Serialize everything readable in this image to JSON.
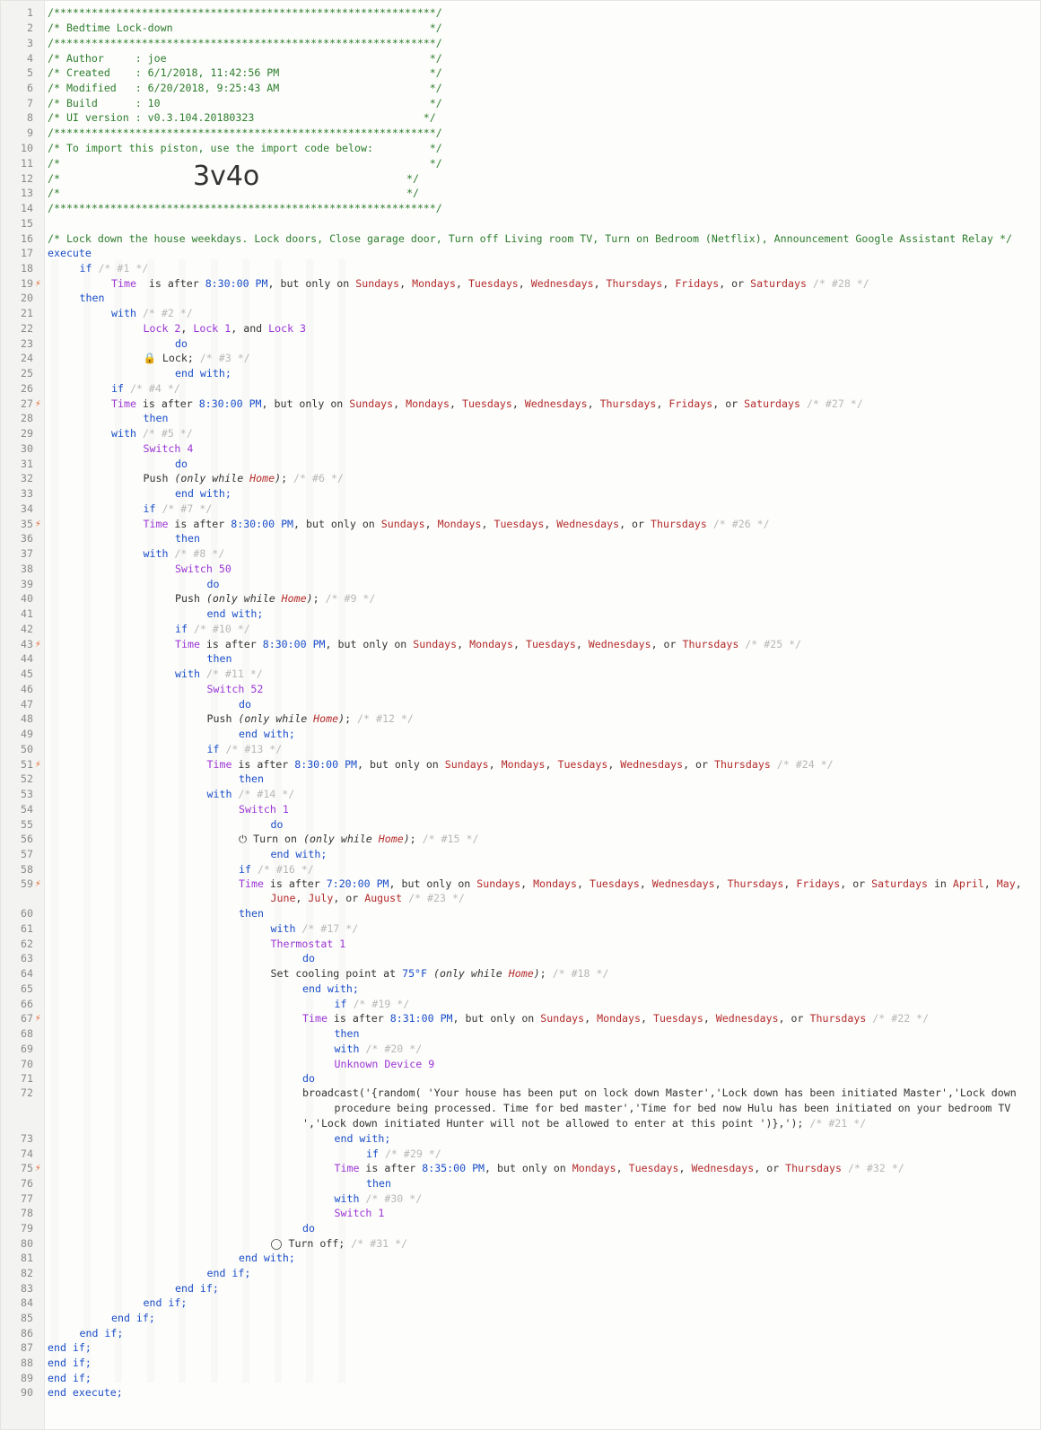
{
  "header": {
    "stars": "/*************************************************************/",
    "title": "/* Bedtime Lock-down                                         */",
    "author": "/* Author     : joe                                          */",
    "created": "/* Created    : 6/1/2018, 11:42:56 PM                        */",
    "modified": "/* Modified   : 6/20/2018, 9:25:43 AM                        */",
    "build": "/* Build      : 10                                           */",
    "ui_version": "/* UI version : v0.3.104.20180323                           */",
    "import_note": "/* To import this piston, use the import code below:         */",
    "blank": "/*                                                           */",
    "blank_left": "/*",
    "blank_right": "*/",
    "import_code": "3v4o"
  },
  "description": "/* Lock down the house weekdays. Lock doors, Close garage door, Turn off Living room TV, Turn on Bedroom (Netflix), Announcement Google Assistant Relay */",
  "lines": [
    {
      "n": "17",
      "segs": [
        [
          "kw",
          "execute"
        ]
      ]
    },
    {
      "n": "18",
      "segs": [
        [
          "kw",
          "if"
        ],
        [
          "dim",
          " /* #1 */"
        ]
      ]
    },
    {
      "n": "19",
      "bolt": true,
      "segs": [
        [
          "dev",
          "Time"
        ],
        [
          "",
          "  is after "
        ],
        [
          "kw",
          "8:30:00 PM"
        ],
        [
          "",
          ", but only on "
        ],
        [
          "red",
          "Sundays"
        ],
        [
          "",
          ", "
        ],
        [
          "red",
          "Mondays"
        ],
        [
          "",
          ", "
        ],
        [
          "red",
          "Tuesdays"
        ],
        [
          "",
          ", "
        ],
        [
          "red",
          "Wednesdays"
        ],
        [
          "",
          ", "
        ],
        [
          "red",
          "Thursdays"
        ],
        [
          "",
          ", "
        ],
        [
          "red",
          "Fridays"
        ],
        [
          "",
          ", or "
        ],
        [
          "red",
          "Saturdays"
        ],
        [
          "dim",
          " /* #28 */"
        ]
      ]
    },
    {
      "n": "20",
      "segs": [
        [
          "kw",
          "then"
        ]
      ]
    },
    {
      "n": "21",
      "segs": [
        [
          "kw",
          "with"
        ],
        [
          "dim",
          " /* #2 */"
        ]
      ]
    },
    {
      "n": "22",
      "segs": [
        [
          "dev",
          "Lock 2"
        ],
        [
          "",
          ", "
        ],
        [
          "dev",
          "Lock 1"
        ],
        [
          "",
          ", and "
        ],
        [
          "dev",
          "Lock 3"
        ]
      ]
    },
    {
      "n": "23",
      "segs": [
        [
          "kw",
          "do"
        ]
      ]
    },
    {
      "n": "24",
      "segs": [
        [
          "icon",
          "🔒"
        ],
        [
          "",
          " Lock;"
        ],
        [
          "dim",
          " /* #3 */"
        ]
      ]
    },
    {
      "n": "25",
      "segs": [
        [
          "kw",
          "end with;"
        ]
      ]
    },
    {
      "n": "26",
      "segs": [
        [
          "kw",
          "if"
        ],
        [
          "dim",
          " /* #4 */"
        ]
      ]
    },
    {
      "n": "27",
      "bolt": true,
      "segs": [
        [
          "dev",
          "Time"
        ],
        [
          "",
          " is after "
        ],
        [
          "kw",
          "8:30:00 PM"
        ],
        [
          "",
          ", but only on "
        ],
        [
          "red",
          "Sundays"
        ],
        [
          "",
          ", "
        ],
        [
          "red",
          "Mondays"
        ],
        [
          "",
          ", "
        ],
        [
          "red",
          "Tuesdays"
        ],
        [
          "",
          ", "
        ],
        [
          "red",
          "Wednesdays"
        ],
        [
          "",
          ", "
        ],
        [
          "red",
          "Thursdays"
        ],
        [
          "",
          ", "
        ],
        [
          "red",
          "Fridays"
        ],
        [
          "",
          ", or "
        ],
        [
          "red",
          "Saturdays"
        ],
        [
          "dim",
          " /* #27 */"
        ]
      ]
    },
    {
      "n": "28",
      "segs": [
        [
          "kw",
          "then"
        ]
      ]
    },
    {
      "n": "29",
      "segs": [
        [
          "kw",
          "with"
        ],
        [
          "dim",
          " /* #5 */"
        ]
      ]
    },
    {
      "n": "30",
      "segs": [
        [
          "dev",
          "Switch 4"
        ]
      ]
    },
    {
      "n": "31",
      "segs": [
        [
          "kw",
          "do"
        ]
      ]
    },
    {
      "n": "32",
      "segs": [
        [
          "",
          "Push "
        ],
        [
          "ital",
          "(only while "
        ],
        [
          "red ital",
          "Home"
        ],
        [
          "ital",
          ")"
        ],
        [
          "",
          ";"
        ],
        [
          "dim",
          " /* #6 */"
        ]
      ]
    },
    {
      "n": "33",
      "segs": [
        [
          "kw",
          "end with;"
        ]
      ]
    },
    {
      "n": "34",
      "segs": [
        [
          "kw",
          "if"
        ],
        [
          "dim",
          " /* #7 */"
        ]
      ]
    },
    {
      "n": "35",
      "bolt": true,
      "segs": [
        [
          "dev",
          "Time"
        ],
        [
          "",
          " is after "
        ],
        [
          "kw",
          "8:30:00 PM"
        ],
        [
          "",
          ", but only on "
        ],
        [
          "red",
          "Sundays"
        ],
        [
          "",
          ", "
        ],
        [
          "red",
          "Mondays"
        ],
        [
          "",
          ", "
        ],
        [
          "red",
          "Tuesdays"
        ],
        [
          "",
          ", "
        ],
        [
          "red",
          "Wednesdays"
        ],
        [
          "",
          ", or "
        ],
        [
          "red",
          "Thursdays"
        ],
        [
          "dim",
          " /* #26 */"
        ]
      ]
    },
    {
      "n": "36",
      "segs": [
        [
          "kw",
          "then"
        ]
      ]
    },
    {
      "n": "37",
      "segs": [
        [
          "kw",
          "with"
        ],
        [
          "dim",
          " /* #8 */"
        ]
      ]
    },
    {
      "n": "38",
      "segs": [
        [
          "dev",
          "Switch 50"
        ]
      ]
    },
    {
      "n": "39",
      "segs": [
        [
          "kw",
          "do"
        ]
      ]
    },
    {
      "n": "40",
      "segs": [
        [
          "",
          "Push "
        ],
        [
          "ital",
          "(only while "
        ],
        [
          "red ital",
          "Home"
        ],
        [
          "ital",
          ")"
        ],
        [
          "",
          ";"
        ],
        [
          "dim",
          " /* #9 */"
        ]
      ]
    },
    {
      "n": "41",
      "segs": [
        [
          "kw",
          "end with;"
        ]
      ]
    },
    {
      "n": "42",
      "segs": [
        [
          "kw",
          "if"
        ],
        [
          "dim",
          " /* #10 */"
        ]
      ]
    },
    {
      "n": "43",
      "bolt": true,
      "segs": [
        [
          "dev",
          "Time"
        ],
        [
          "",
          " is after "
        ],
        [
          "kw",
          "8:30:00 PM"
        ],
        [
          "",
          ", but only on "
        ],
        [
          "red",
          "Sundays"
        ],
        [
          "",
          ", "
        ],
        [
          "red",
          "Mondays"
        ],
        [
          "",
          ", "
        ],
        [
          "red",
          "Tuesdays"
        ],
        [
          "",
          ", "
        ],
        [
          "red",
          "Wednesdays"
        ],
        [
          "",
          ", or "
        ],
        [
          "red",
          "Thursdays"
        ],
        [
          "dim",
          " /* #25 */"
        ]
      ]
    },
    {
      "n": "44",
      "segs": [
        [
          "kw",
          "then"
        ]
      ]
    },
    {
      "n": "45",
      "segs": [
        [
          "kw",
          "with"
        ],
        [
          "dim",
          " /* #11 */"
        ]
      ]
    },
    {
      "n": "46",
      "segs": [
        [
          "dev",
          "Switch 52"
        ]
      ]
    },
    {
      "n": "47",
      "segs": [
        [
          "kw",
          "do"
        ]
      ]
    },
    {
      "n": "48",
      "segs": [
        [
          "",
          "Push "
        ],
        [
          "ital",
          "(only while "
        ],
        [
          "red ital",
          "Home"
        ],
        [
          "ital",
          ")"
        ],
        [
          "",
          ";"
        ],
        [
          "dim",
          " /* #12 */"
        ]
      ]
    },
    {
      "n": "49",
      "segs": [
        [
          "kw",
          "end with;"
        ]
      ]
    },
    {
      "n": "50",
      "segs": [
        [
          "kw",
          "if"
        ],
        [
          "dim",
          " /* #13 */"
        ]
      ]
    },
    {
      "n": "51",
      "bolt": true,
      "segs": [
        [
          "dev",
          "Time"
        ],
        [
          "",
          " is after "
        ],
        [
          "kw",
          "8:30:00 PM"
        ],
        [
          "",
          ", but only on "
        ],
        [
          "red",
          "Sundays"
        ],
        [
          "",
          ", "
        ],
        [
          "red",
          "Mondays"
        ],
        [
          "",
          ", "
        ],
        [
          "red",
          "Tuesdays"
        ],
        [
          "",
          ", "
        ],
        [
          "red",
          "Wednesdays"
        ],
        [
          "",
          ", or "
        ],
        [
          "red",
          "Thursdays"
        ],
        [
          "dim",
          " /* #24 */"
        ]
      ]
    },
    {
      "n": "52",
      "segs": [
        [
          "kw",
          "then"
        ]
      ]
    },
    {
      "n": "53",
      "segs": [
        [
          "kw",
          "with"
        ],
        [
          "dim",
          " /* #14 */"
        ]
      ]
    },
    {
      "n": "54",
      "segs": [
        [
          "dev",
          "Switch 1"
        ]
      ]
    },
    {
      "n": "55",
      "segs": [
        [
          "kw",
          "do"
        ]
      ]
    },
    {
      "n": "56",
      "segs": [
        [
          "icon",
          "⏻"
        ],
        [
          "",
          " Turn on "
        ],
        [
          "ital",
          "(only while "
        ],
        [
          "red ital",
          "Home"
        ],
        [
          "ital",
          ")"
        ],
        [
          "",
          ";"
        ],
        [
          "dim",
          " /* #15 */"
        ]
      ]
    },
    {
      "n": "57",
      "segs": [
        [
          "kw",
          "end with;"
        ]
      ]
    },
    {
      "n": "58",
      "segs": [
        [
          "kw",
          "if"
        ],
        [
          "dim",
          " /* #16 */"
        ]
      ]
    },
    {
      "n": "59",
      "bolt": true,
      "segs": [
        [
          "dev",
          "Time"
        ],
        [
          "",
          " is after "
        ],
        [
          "kw",
          "7:20:00 PM"
        ],
        [
          "",
          ", but only on "
        ],
        [
          "red",
          "Sundays"
        ],
        [
          "",
          ", "
        ],
        [
          "red",
          "Mondays"
        ],
        [
          "",
          ", "
        ],
        [
          "red",
          "Tuesdays"
        ],
        [
          "",
          ", "
        ],
        [
          "red",
          "Wednesdays"
        ],
        [
          "",
          ", "
        ],
        [
          "red",
          "Thursdays"
        ],
        [
          "",
          ", "
        ],
        [
          "red",
          "Fridays"
        ],
        [
          "",
          ", or "
        ],
        [
          "red",
          "Saturdays"
        ],
        [
          "",
          " in "
        ],
        [
          "red",
          "April"
        ],
        [
          "",
          ", "
        ],
        [
          "red",
          "May"
        ],
        [
          "",
          ","
        ]
      ]
    },
    {
      "n": "",
      "segs": [
        [
          "red",
          "June"
        ],
        [
          "",
          ", "
        ],
        [
          "red",
          "July"
        ],
        [
          "",
          ", or "
        ],
        [
          "red",
          "August"
        ],
        [
          "dim",
          " /* #23 */"
        ]
      ]
    },
    {
      "n": "60",
      "segs": [
        [
          "kw",
          "then"
        ]
      ]
    },
    {
      "n": "61",
      "segs": [
        [
          "kw",
          "with"
        ],
        [
          "dim",
          " /* #17 */"
        ]
      ]
    },
    {
      "n": "62",
      "segs": [
        [
          "dev",
          "Thermostat 1"
        ]
      ]
    },
    {
      "n": "63",
      "segs": [
        [
          "kw",
          "do"
        ]
      ]
    },
    {
      "n": "64",
      "segs": [
        [
          "",
          "Set cooling point at "
        ],
        [
          "kw",
          "75°F"
        ],
        [
          "",
          " "
        ],
        [
          "ital",
          "(only while "
        ],
        [
          "red ital",
          "Home"
        ],
        [
          "ital",
          ")"
        ],
        [
          "",
          ";"
        ],
        [
          "dim",
          " /* #18 */"
        ]
      ]
    },
    {
      "n": "65",
      "segs": [
        [
          "kw",
          "end with;"
        ]
      ]
    },
    {
      "n": "66",
      "segs": [
        [
          "kw",
          "if"
        ],
        [
          "dim",
          " /* #19 */"
        ]
      ]
    },
    {
      "n": "67",
      "bolt": true,
      "segs": [
        [
          "dev",
          "Time"
        ],
        [
          "",
          " is after "
        ],
        [
          "kw",
          "8:31:00 PM"
        ],
        [
          "",
          ", but only on "
        ],
        [
          "red",
          "Sundays"
        ],
        [
          "",
          ", "
        ],
        [
          "red",
          "Mondays"
        ],
        [
          "",
          ", "
        ],
        [
          "red",
          "Tuesdays"
        ],
        [
          "",
          ", "
        ],
        [
          "red",
          "Wednesdays"
        ],
        [
          "",
          ", or "
        ],
        [
          "red",
          "Thursdays"
        ],
        [
          "dim",
          " /* #22 */"
        ]
      ]
    },
    {
      "n": "68",
      "segs": [
        [
          "kw",
          "then"
        ]
      ]
    },
    {
      "n": "69",
      "segs": [
        [
          "kw",
          "with"
        ],
        [
          "dim",
          " /* #20 */"
        ]
      ]
    },
    {
      "n": "70",
      "segs": [
        [
          "dev",
          "Unknown Device 9"
        ]
      ]
    },
    {
      "n": "71",
      "segs": [
        [
          "kw",
          "do"
        ]
      ]
    },
    {
      "n": "72",
      "segs": [
        [
          "",
          "broadcast('{random( 'Your house has been put on lock down Master','Lock down has been initiated Master','Lock down"
        ]
      ]
    },
    {
      "n": "",
      "segs": [
        [
          "",
          "procedure being processed. Time for bed master','Time for bed now Hulu has been initiated on your bedroom TV"
        ]
      ]
    },
    {
      "n": "",
      "segs": [
        [
          "",
          "','Lock down initiated Hunter will not be allowed to enter at this point ')},');"
        ],
        [
          "dim",
          " /* #21 */"
        ]
      ]
    },
    {
      "n": "73",
      "segs": [
        [
          "kw",
          "end with;"
        ]
      ]
    },
    {
      "n": "74",
      "segs": [
        [
          "kw",
          "if"
        ],
        [
          "dim",
          " /* #29 */"
        ]
      ]
    },
    {
      "n": "75",
      "bolt": true,
      "segs": [
        [
          "dev",
          "Time"
        ],
        [
          "",
          " is after "
        ],
        [
          "kw",
          "8:35:00 PM"
        ],
        [
          "",
          ", but only on "
        ],
        [
          "red",
          "Mondays"
        ],
        [
          "",
          ", "
        ],
        [
          "red",
          "Tuesdays"
        ],
        [
          "",
          ", "
        ],
        [
          "red",
          "Wednesdays"
        ],
        [
          "",
          ", or "
        ],
        [
          "red",
          "Thursdays"
        ],
        [
          "dim",
          " /* #32 */"
        ]
      ]
    },
    {
      "n": "76",
      "segs": [
        [
          "kw",
          "then"
        ]
      ]
    },
    {
      "n": "77",
      "segs": [
        [
          "kw",
          "with"
        ],
        [
          "dim",
          " /* #30 */"
        ]
      ]
    },
    {
      "n": "78",
      "segs": [
        [
          "dev",
          "Switch 1"
        ]
      ]
    },
    {
      "n": "79",
      "segs": [
        [
          "kw",
          "do"
        ]
      ]
    },
    {
      "n": "80",
      "segs": [
        [
          "icon",
          "◯"
        ],
        [
          "",
          " Turn off;"
        ],
        [
          "dim",
          " /* #31 */"
        ]
      ]
    },
    {
      "n": "81",
      "segs": [
        [
          "kw",
          "end with;"
        ]
      ]
    },
    {
      "n": "82",
      "segs": [
        [
          "kw",
          "end if;"
        ]
      ]
    },
    {
      "n": "83",
      "segs": [
        [
          "kw",
          "end if;"
        ]
      ]
    },
    {
      "n": "84",
      "segs": [
        [
          "kw",
          "end if;"
        ]
      ]
    },
    {
      "n": "85",
      "segs": [
        [
          "kw",
          "end if;"
        ]
      ]
    },
    {
      "n": "86",
      "segs": [
        [
          "kw",
          "end if;"
        ]
      ]
    },
    {
      "n": "87",
      "segs": [
        [
          "kw",
          "end if;"
        ]
      ]
    },
    {
      "n": "88",
      "segs": [
        [
          "kw",
          "end if;"
        ]
      ]
    },
    {
      "n": "89",
      "segs": [
        [
          "kw",
          "end if;"
        ]
      ]
    },
    {
      "n": "90",
      "segs": [
        [
          "kw",
          "end execute;"
        ]
      ]
    }
  ]
}
